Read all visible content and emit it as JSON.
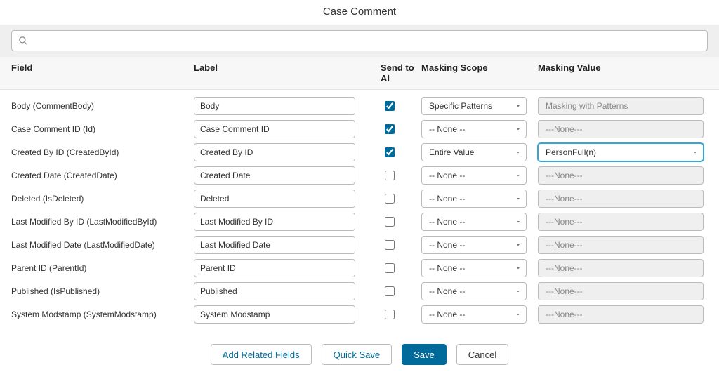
{
  "title": "Case Comment",
  "search": {
    "placeholder": ""
  },
  "headers": {
    "field": "Field",
    "label": "Label",
    "sendai": "Send to AI",
    "scope": "Masking Scope",
    "value": "Masking Value"
  },
  "rows": [
    {
      "field": "Body (CommentBody)",
      "label": "Body",
      "sendai": true,
      "scope": "Specific Patterns",
      "value": "Masking with Patterns",
      "value_mode": "disabled"
    },
    {
      "field": "Case Comment ID (Id)",
      "label": "Case Comment ID",
      "sendai": true,
      "scope": "-- None --",
      "value": "---None---",
      "value_mode": "disabled"
    },
    {
      "field": "Created By ID (CreatedById)",
      "label": "Created By ID",
      "sendai": true,
      "scope": "Entire Value",
      "value": "PersonFull(n)",
      "value_mode": "active"
    },
    {
      "field": "Created Date (CreatedDate)",
      "label": "Created Date",
      "sendai": false,
      "scope": "-- None --",
      "value": "---None---",
      "value_mode": "disabled"
    },
    {
      "field": "Deleted (IsDeleted)",
      "label": "Deleted",
      "sendai": false,
      "scope": "-- None --",
      "value": "---None---",
      "value_mode": "disabled"
    },
    {
      "field": "Last Modified By ID (LastModifiedById)",
      "label": "Last Modified By ID",
      "sendai": false,
      "scope": "-- None --",
      "value": "---None---",
      "value_mode": "disabled"
    },
    {
      "field": "Last Modified Date (LastModifiedDate)",
      "label": "Last Modified Date",
      "sendai": false,
      "scope": "-- None --",
      "value": "---None---",
      "value_mode": "disabled"
    },
    {
      "field": "Parent ID (ParentId)",
      "label": "Parent ID",
      "sendai": false,
      "scope": "-- None --",
      "value": "---None---",
      "value_mode": "disabled"
    },
    {
      "field": "Published (IsPublished)",
      "label": "Published",
      "sendai": false,
      "scope": "-- None --",
      "value": "---None---",
      "value_mode": "disabled"
    },
    {
      "field": "System Modstamp (SystemModstamp)",
      "label": "System Modstamp",
      "sendai": false,
      "scope": "-- None --",
      "value": "---None---",
      "value_mode": "disabled"
    }
  ],
  "footer": {
    "add_related": "Add Related Fields",
    "quick_save": "Quick Save",
    "save": "Save",
    "cancel": "Cancel"
  }
}
